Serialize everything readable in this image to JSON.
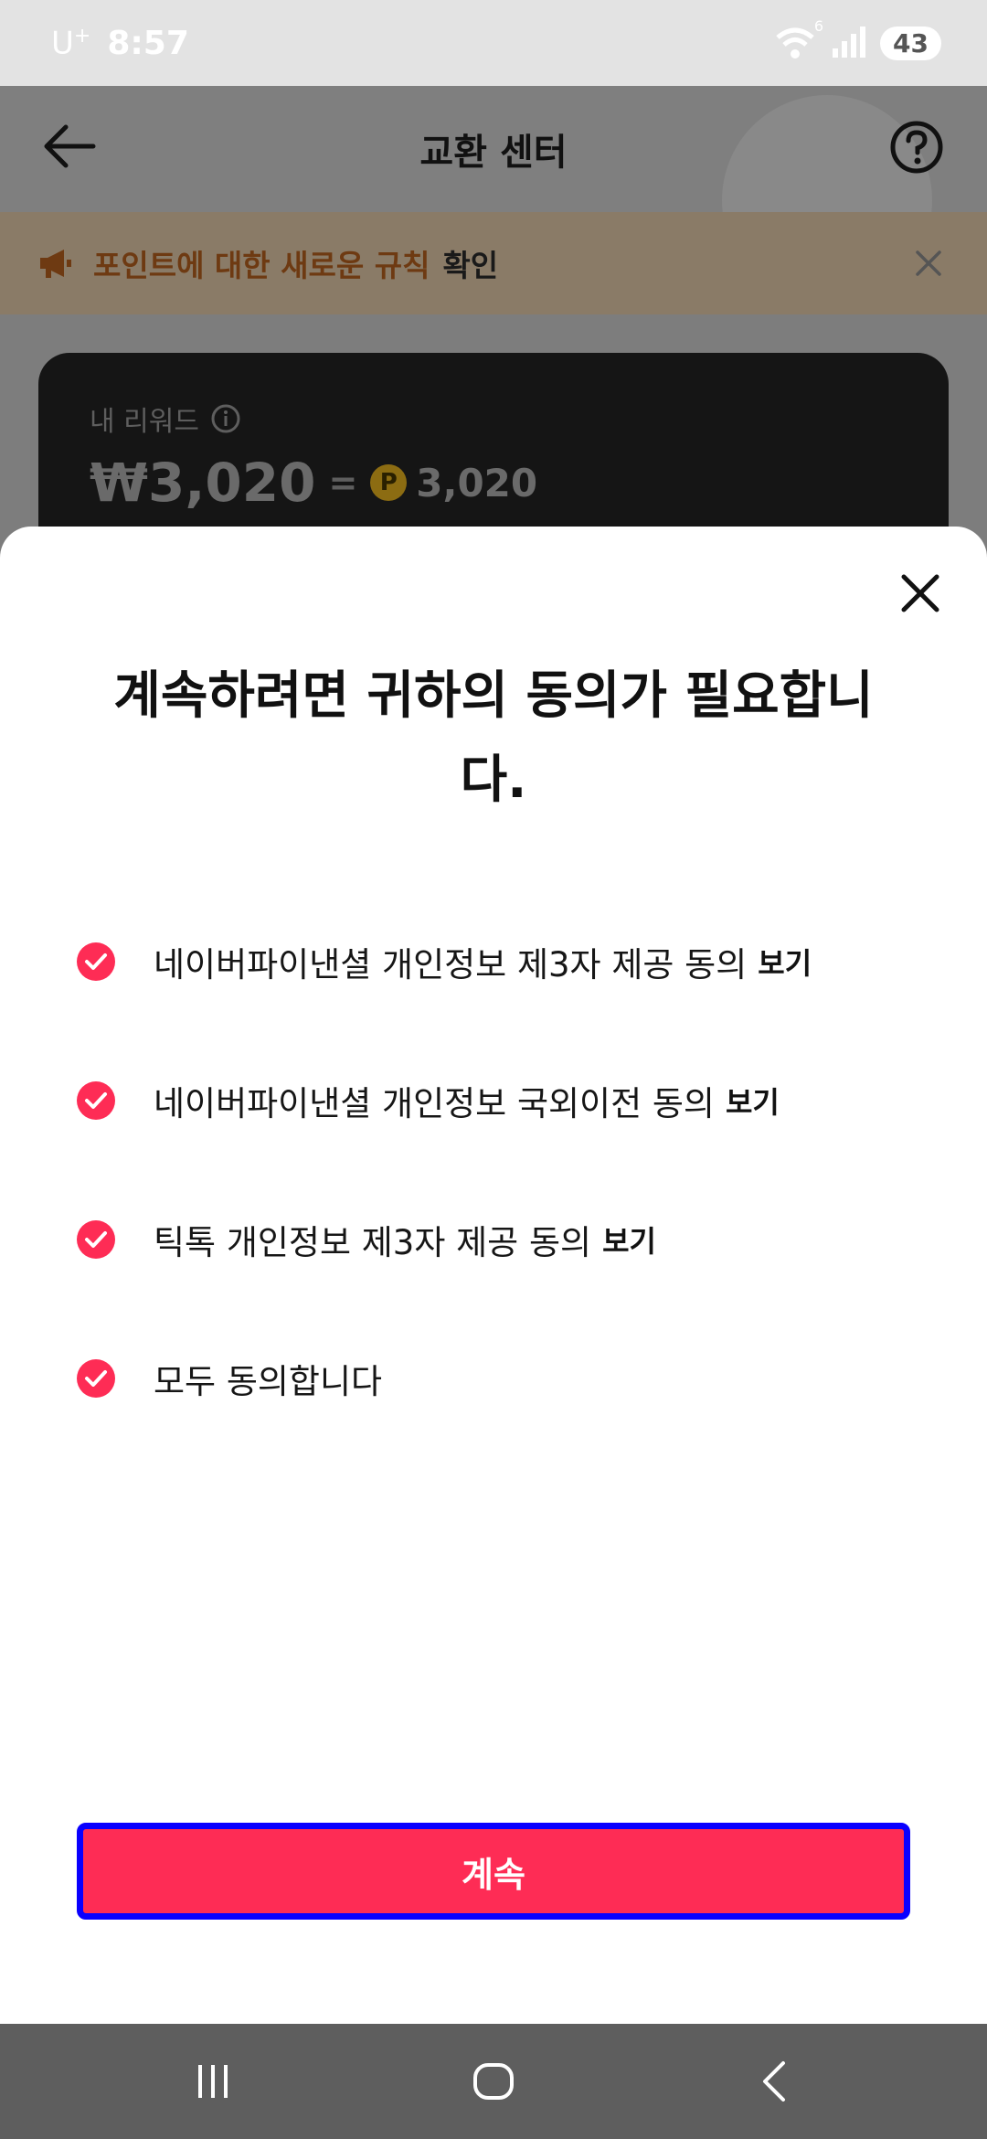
{
  "status_bar": {
    "carrier": "U",
    "carrier_sup": "+",
    "time": "8:57",
    "battery": "43",
    "wifi_badge": "6"
  },
  "header": {
    "title": "교환 센터"
  },
  "notice": {
    "text": "포인트에 대한 새로운 규칙",
    "link": "확인"
  },
  "reward": {
    "label": "내 리워드",
    "amount": "₩3,020",
    "equals": "=",
    "coin_letter": "P",
    "points": "3,020"
  },
  "sheet": {
    "title": "계속하려면 귀하의 동의가 필요합니다.",
    "consents": [
      {
        "text": "네이버파이낸셜 개인정보 제3자 제공 동의",
        "view": "보기"
      },
      {
        "text": "네이버파이낸셜 개인정보 국외이전 동의",
        "view": "보기"
      },
      {
        "text": "틱톡 개인정보 제3자 제공 동의",
        "view": "보기"
      },
      {
        "text": "모두 동의합니다",
        "view": ""
      }
    ],
    "continue_label": "계속"
  },
  "colors": {
    "accent": "#fe2c55",
    "focus_border": "#0a00ff"
  }
}
